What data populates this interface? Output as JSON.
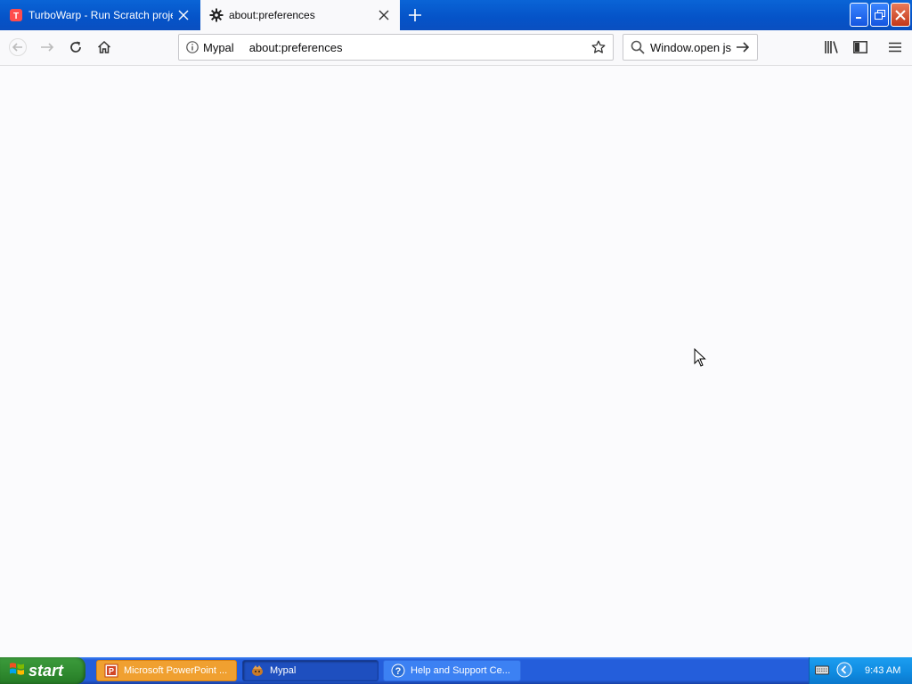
{
  "tabs": [
    {
      "title": "TurboWarp - Run Scratch projects faster",
      "state": "inactive",
      "icon": "turbowarp-icon"
    },
    {
      "title": "about:preferences",
      "state": "active",
      "icon": "gear-icon"
    }
  ],
  "navbar": {
    "identity_label": "Mypal",
    "url": "about:preferences",
    "search_value": "Window.open js"
  },
  "taskbar": {
    "start_label": "start",
    "tasks": [
      {
        "label": "Microsoft PowerPoint ...",
        "icon": "powerpoint-icon"
      },
      {
        "label": "Mypal",
        "icon": "mypal-icon"
      },
      {
        "label": "Help and Support Ce...",
        "icon": "help-icon"
      }
    ],
    "clock": "9:43 AM"
  },
  "colors": {
    "titlebar": "#0553c8",
    "taskbar": "#245edb",
    "start_button": "#2f8a2f",
    "content_bg": "#fbfbfd"
  }
}
